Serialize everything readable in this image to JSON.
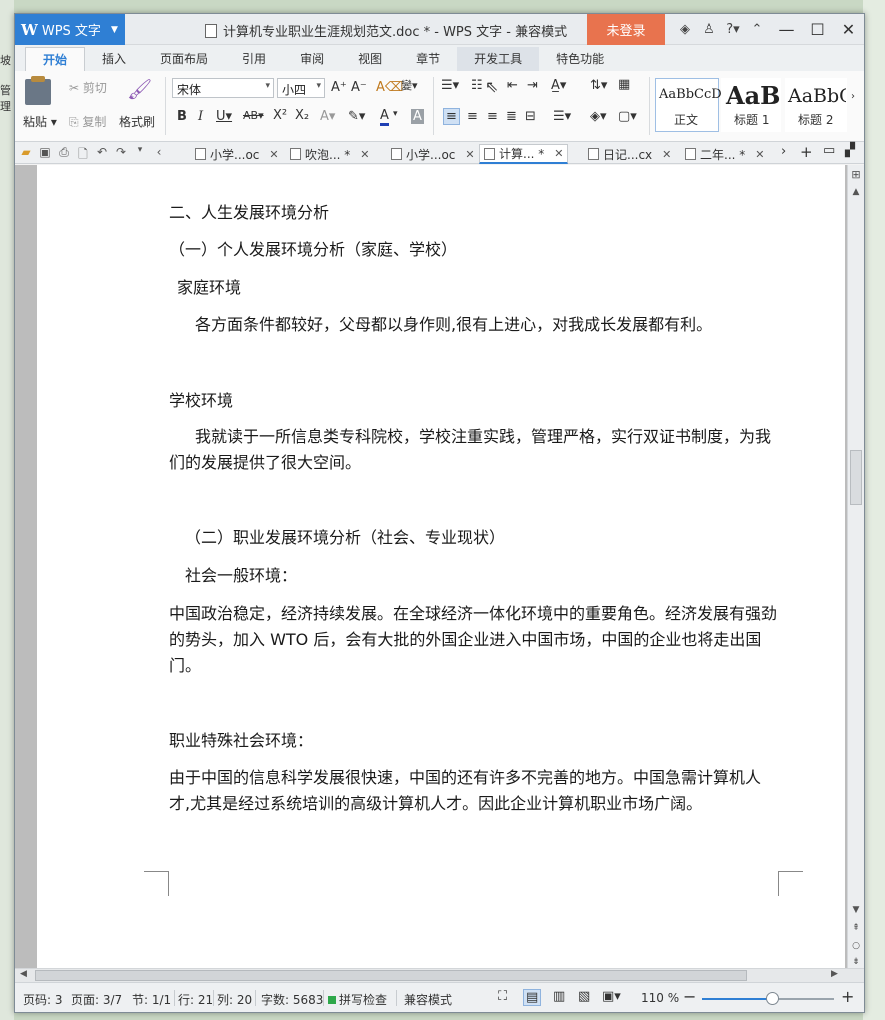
{
  "window": {
    "app_name": "WPS 文字",
    "title": "计算机专业职业生涯规划范文.doc * - WPS 文字 - 兼容模式",
    "login_label": "未登录"
  },
  "ribbon_tabs": [
    "开始",
    "插入",
    "页面布局",
    "引用",
    "审阅",
    "视图",
    "章节",
    "开发工具",
    "特色功能"
  ],
  "ribbon": {
    "paste": "粘贴",
    "cut": "剪切",
    "copy": "复制",
    "format_painter": "格式刷",
    "font_name": "宋体",
    "font_size": "小四",
    "styles": [
      {
        "sample": "AaBbCcD",
        "name": "正文"
      },
      {
        "sample": "AaB",
        "name": "标题 1"
      },
      {
        "sample": "AaBbC",
        "name": "标题 2"
      }
    ]
  },
  "doc_tabs": [
    {
      "label": "小学...oc",
      "active": false
    },
    {
      "label": "吹泡... *",
      "active": false
    },
    {
      "label": "小学...oc",
      "active": false
    },
    {
      "label": "计算... *",
      "active": true
    },
    {
      "label": "日记...cx",
      "active": false
    },
    {
      "label": "二年... *",
      "active": false
    }
  ],
  "document": {
    "h2": "二、人生发展环境分析",
    "h3a": "（一）个人发展环境分析（家庭、学校）",
    "family_title": "家庭环境",
    "family_text": "各方面条件都较好，父母都以身作则,很有上进心，对我成长发展都有利。",
    "school_title": "学校环境",
    "school_text": "我就读于一所信息类专科院校，学校注重实践，管理严格，实行双证书制度，为我们的发展提供了很大空间。",
    "h3b": "（二）职业发展环境分析（社会、专业现状）",
    "society_title": "社会一般环境：",
    "society_text": "中国政治稳定，经济持续发展。在全球经济一体化环境中的重要角色。经济发展有强劲的势头，加入 WTO 后，会有大批的外国企业进入中国市场，中国的企业也将走出国门。",
    "special_title": "职业特殊社会环境：",
    "special_text": "由于中国的信息科学发展很快速，中国的还有许多不完善的地方。中国急需计算机人才,尤其是经过系统培训的高级计算机人才。因此企业计算机职业市场广阔。"
  },
  "status": {
    "page_num": "页码: 3",
    "pages": "页面: 3/7",
    "section": "节: 1/1",
    "row": "行: 21",
    "col": "列: 20",
    "words": "字数: 5683",
    "spell": "拼写检查",
    "compat": "兼容模式",
    "zoom": "110 %",
    "zoom_fraction": 0.53
  },
  "background": {
    "left_text_1": "坡",
    "left_text_2": "管理"
  }
}
